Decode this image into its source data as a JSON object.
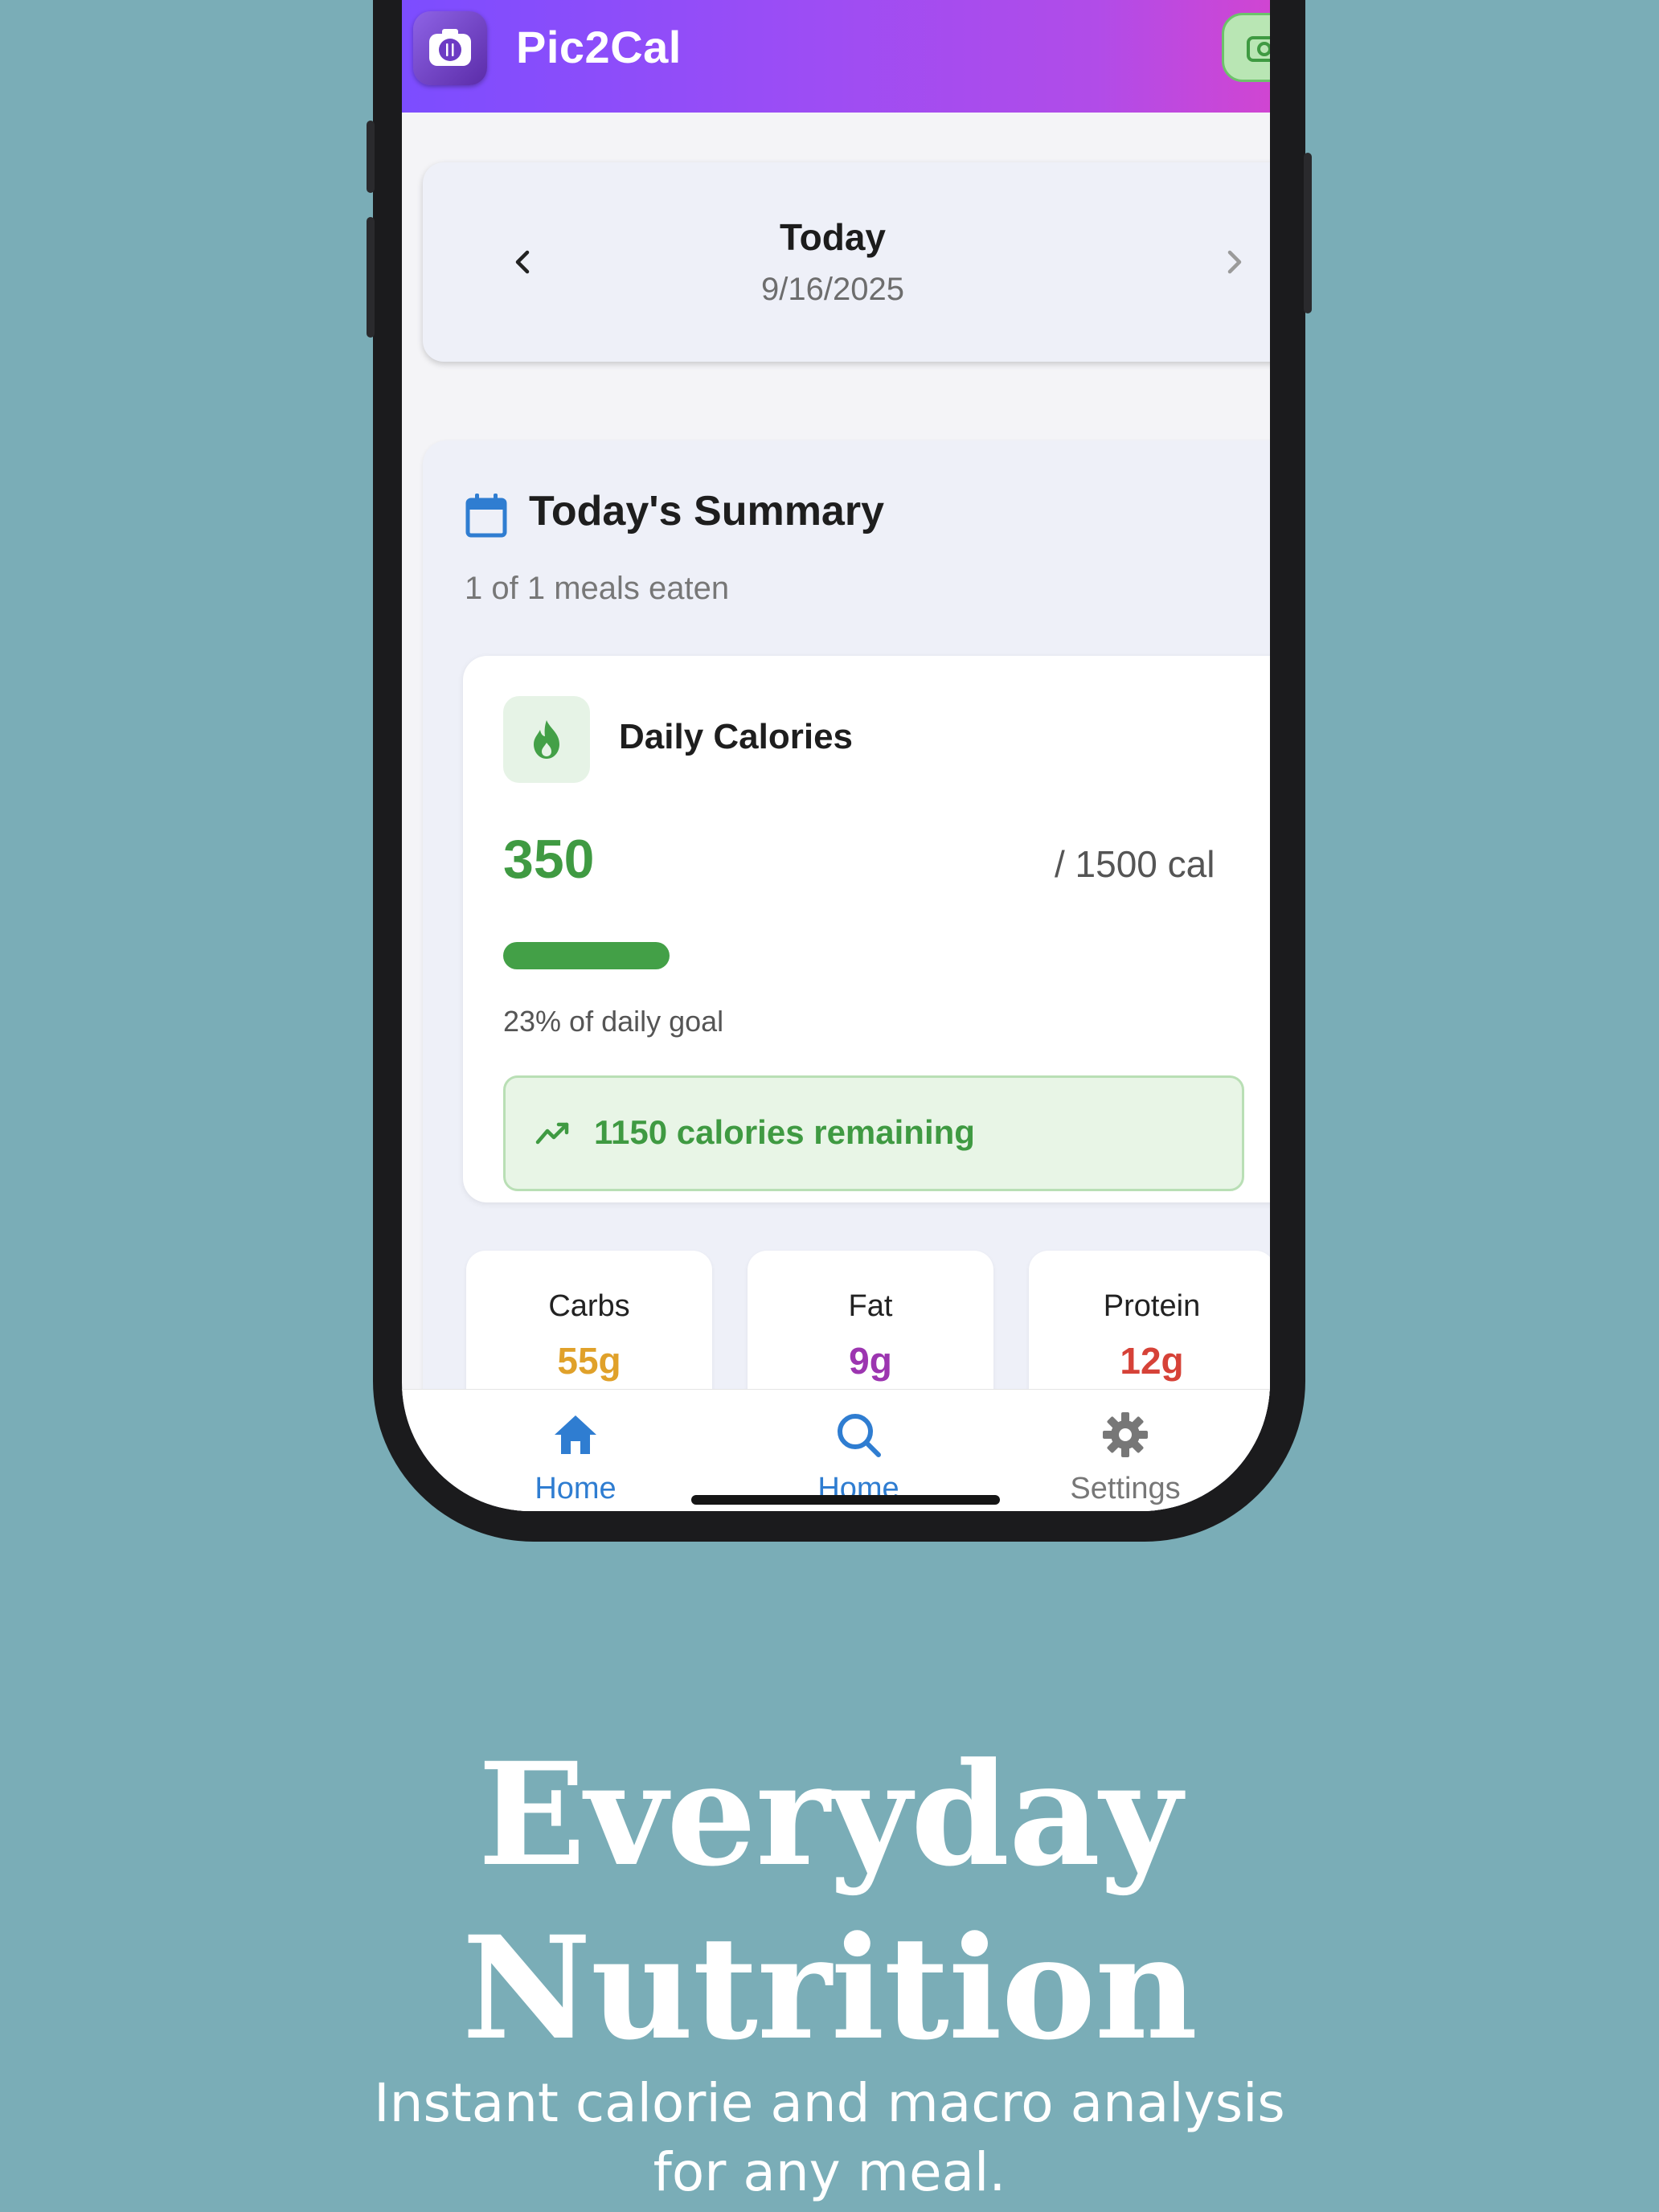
{
  "app": {
    "title": "Pic2Cal"
  },
  "date_nav": {
    "title": "Today",
    "date": "9/16/2025"
  },
  "summary": {
    "title": "Today's Summary",
    "subtitle": "1 of 1 meals eaten"
  },
  "daily_calories": {
    "title": "Daily Calories",
    "value": "350",
    "goal": "/ 1500 cal",
    "progress_fraction": 0.23,
    "percent_text": "23% of daily goal",
    "remaining_text": "1150 calories remaining"
  },
  "macros": [
    {
      "label": "Carbs",
      "value": "55g",
      "color": "#e0a12a"
    },
    {
      "label": "Fat",
      "value": "9g",
      "color": "#9c35b0"
    },
    {
      "label": "Protein",
      "value": "12g",
      "color": "#d64238"
    }
  ],
  "tabbar": {
    "items": [
      {
        "label": "Home",
        "icon": "home-icon",
        "color": "#2f7dd1"
      },
      {
        "label": "Home",
        "icon": "search-icon",
        "color": "#2f7dd1"
      },
      {
        "label": "Settings",
        "icon": "gear-icon",
        "color": "#777777"
      }
    ]
  },
  "promo": {
    "headline_line1": "Everyday",
    "headline_line2": "Nutrition",
    "tagline_line1": "Instant calorie and macro analysis",
    "tagline_line2": "for any meal."
  },
  "colors": {
    "accent_green": "#43a047",
    "background": "#7aadb7",
    "brand_gradient": "#7c4dff-#d045d2"
  }
}
